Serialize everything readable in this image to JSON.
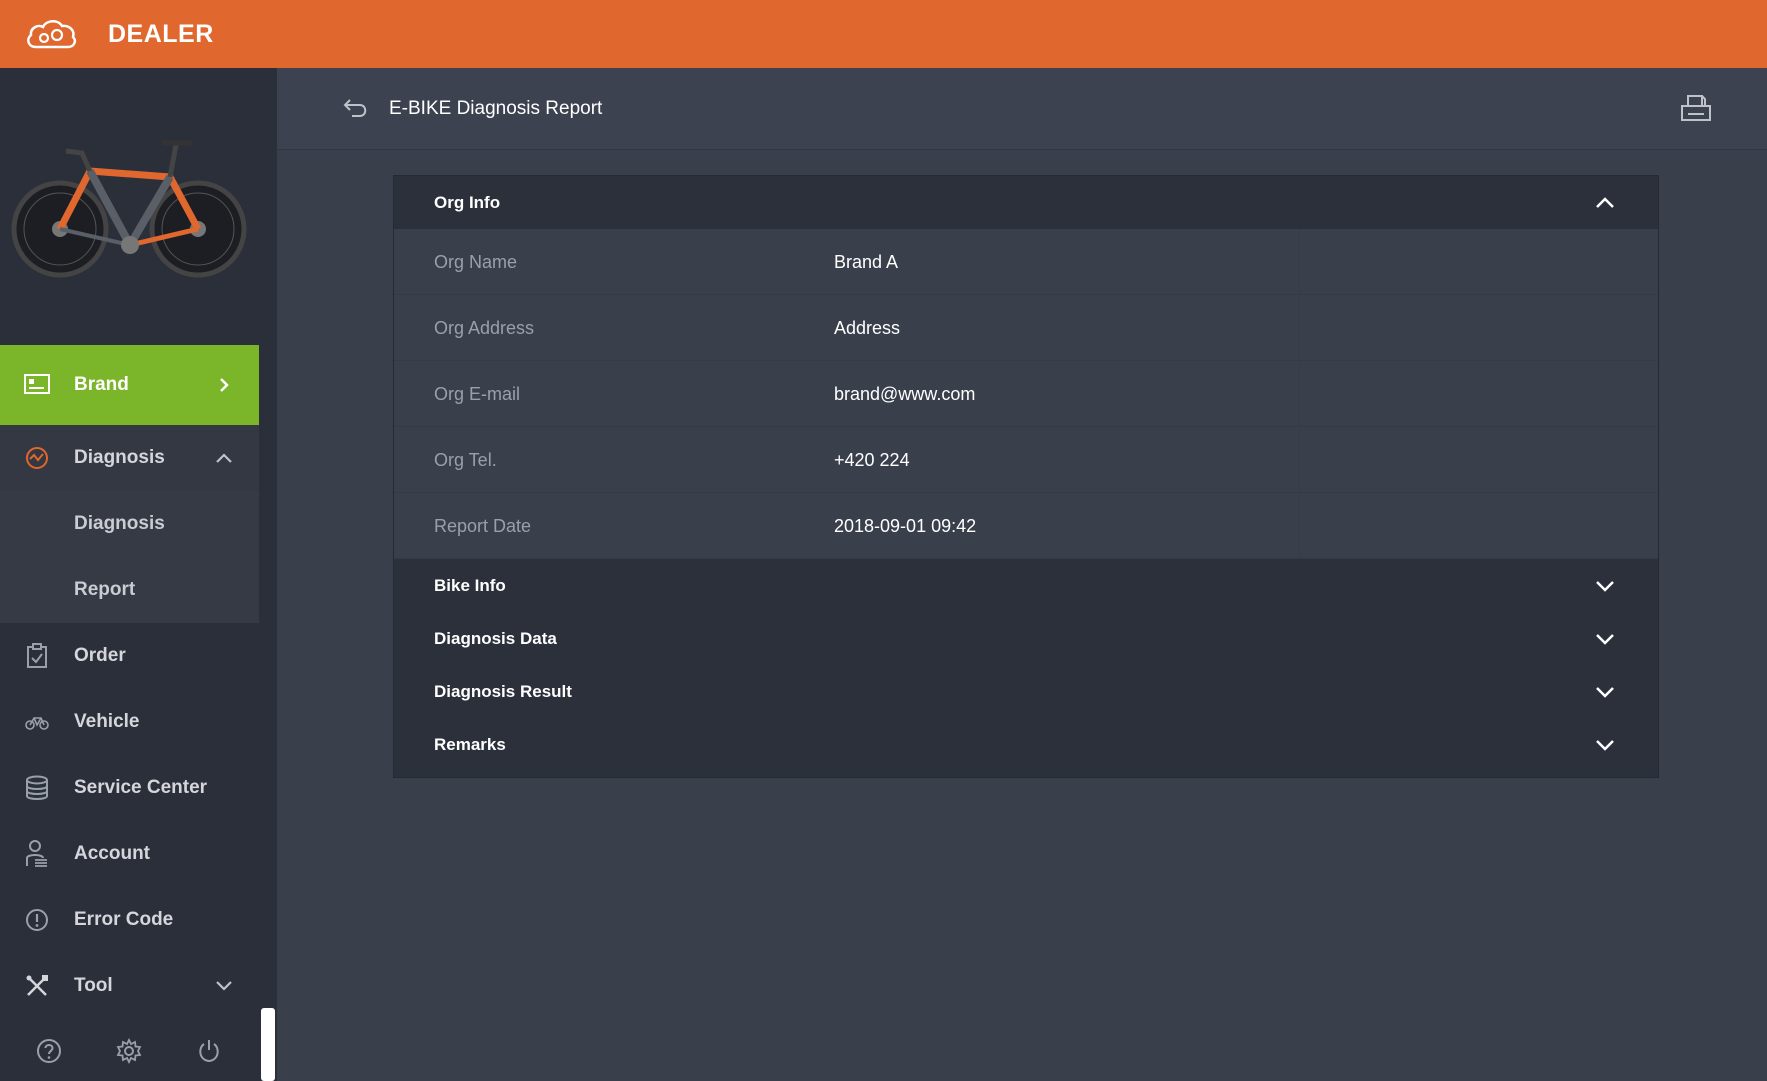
{
  "app": {
    "title": "DEALER"
  },
  "colors": {
    "accent": "#e0672d",
    "active": "#7ab52a",
    "sidebar": "#2b2f39",
    "main": "#3a3f4c"
  },
  "sidebar": {
    "items": [
      {
        "label": "Brand",
        "icon": "brand-icon",
        "state": "active"
      },
      {
        "label": "Diagnosis",
        "icon": "diagnosis-icon",
        "state": "expanded",
        "children": [
          {
            "label": "Diagnosis"
          },
          {
            "label": "Report"
          }
        ]
      },
      {
        "label": "Order",
        "icon": "clipboard-icon"
      },
      {
        "label": "Vehicle",
        "icon": "bicycle-icon"
      },
      {
        "label": "Service Center",
        "icon": "database-icon"
      },
      {
        "label": "Account",
        "icon": "user-icon"
      },
      {
        "label": "Error Code",
        "icon": "alert-icon"
      },
      {
        "label": "Tool",
        "icon": "tool-icon",
        "state": "collapsed"
      }
    ],
    "footer": [
      "help-icon",
      "settings-icon",
      "power-icon"
    ]
  },
  "header": {
    "title": "E-BIKE Diagnosis Report"
  },
  "report": {
    "sections": [
      {
        "title": "Org Info",
        "expanded": true,
        "rows": [
          {
            "label": "Org Name",
            "value": "Brand A"
          },
          {
            "label": "Org Address",
            "value": "Address"
          },
          {
            "label": "Org E-mail",
            "value": "brand@www.com"
          },
          {
            "label": "Org Tel.",
            "value": "+420 224"
          },
          {
            "label": "Report Date",
            "value": "2018-09-01 09:42"
          }
        ]
      },
      {
        "title": "Bike Info",
        "expanded": false
      },
      {
        "title": "Diagnosis Data",
        "expanded": false
      },
      {
        "title": "Diagnosis Result",
        "expanded": false
      },
      {
        "title": "Remarks",
        "expanded": false
      }
    ]
  }
}
